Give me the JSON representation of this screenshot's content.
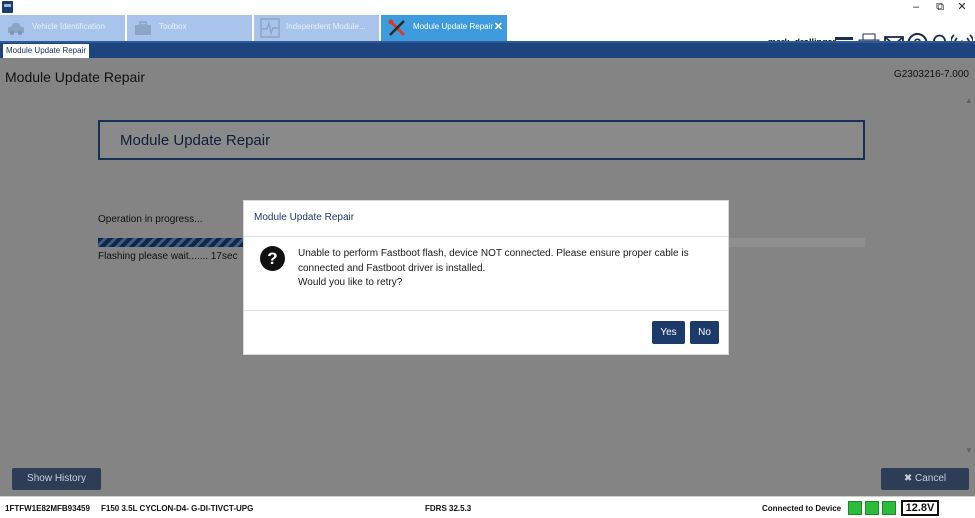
{
  "window": {
    "minimize_glyph": "–",
    "restore_glyph": "⧉",
    "close_glyph": "✕"
  },
  "tabs": [
    {
      "label": "Vehicle Identification",
      "icon": "car-icon",
      "active": false
    },
    {
      "label": "Toolbox",
      "icon": "toolbox-icon",
      "active": false
    },
    {
      "label": "Independent Module...",
      "icon": "waveform-icon",
      "active": false
    },
    {
      "label": "Module Update Repair",
      "icon": "wrench-screwdriver-icon",
      "active": true,
      "close_glyph": "✕"
    }
  ],
  "header": {
    "user": "mark_drollinger",
    "icons": [
      "menu-icon",
      "printer-icon",
      "mail-icon",
      "help-icon",
      "bell-icon",
      "signal-icon"
    ]
  },
  "subtab": {
    "label": "Module Update Repair"
  },
  "page": {
    "title": "Module Update Repair",
    "version": "G2303216-7.000",
    "box_title": "Module Update Repair",
    "operation_label": "Operation in progress...",
    "progress_fraction": 0.19,
    "flash_status": "Flashing please wait....... 17sec",
    "show_history_label": "Show History",
    "cancel_label": "✖ Cancel"
  },
  "dialog": {
    "title": "Module Update Repair",
    "icon": "question-icon",
    "icon_glyph": "?",
    "message_lines": [
      "Unable to perform Fastboot flash, device NOT connected. Please ensure proper cable is",
      "connected and Fastboot driver is installed.",
      "Would you like to retry?"
    ],
    "yes_label": "Yes",
    "no_label": "No"
  },
  "status": {
    "vin": "1FTFW1E82MFB93459",
    "vehicle": "F150 3.5L CYCLON-D4- G-DI-TIVCT-UPG",
    "fdrs": "FDRS 32.5.3",
    "connection": "Connected to Device",
    "voltage": "12.8V",
    "status_color": "#2dbb3a"
  }
}
